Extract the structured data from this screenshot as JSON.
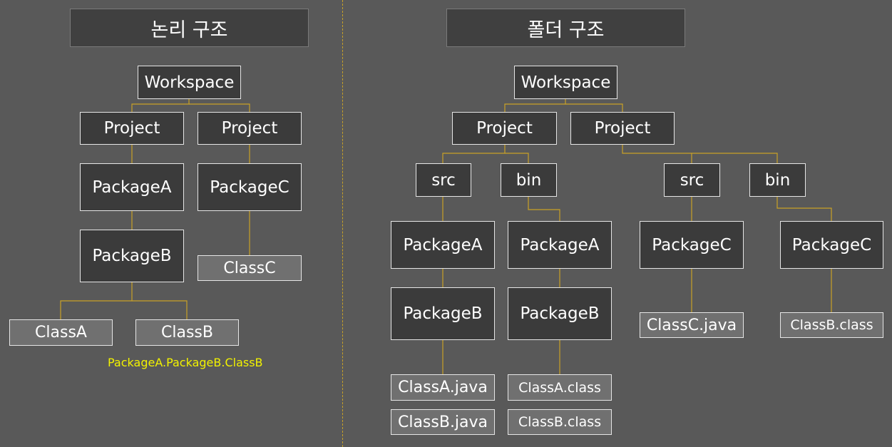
{
  "headers": {
    "logical": "논리 구조",
    "folder": "폴더 구조"
  },
  "logical": {
    "workspace": "Workspace",
    "project_1": "Project",
    "project_2": "Project",
    "package_a": "PackageA",
    "package_b": "PackageB",
    "package_c": "PackageC",
    "class_a": "ClassA",
    "class_b": "ClassB",
    "class_c": "ClassC",
    "qualified_name": "PackageA.PackageB.ClassB"
  },
  "folder": {
    "workspace": "Workspace",
    "project_1": "Project",
    "project_2": "Project",
    "src_1": "src",
    "bin_1": "bin",
    "src_2": "src",
    "bin_2": "bin",
    "src_package_a": "PackageA",
    "src_package_b": "PackageB",
    "bin_package_a": "PackageA",
    "bin_package_b": "PackageB",
    "src2_package_c": "PackageC",
    "bin2_package_c": "PackageC",
    "class_a_java": "ClassA.java",
    "class_b_java": "ClassB.java",
    "class_a_class": "ClassA.class",
    "class_b_class": "ClassB.class",
    "class_c_java": "ClassC.java",
    "class_b_class_2": "ClassB.class"
  },
  "colors": {
    "background": "#595959",
    "box_dark": "#3b3b3b",
    "box_gray": "#707070",
    "connector": "#c9a227",
    "highlight_text": "#f2f200"
  }
}
